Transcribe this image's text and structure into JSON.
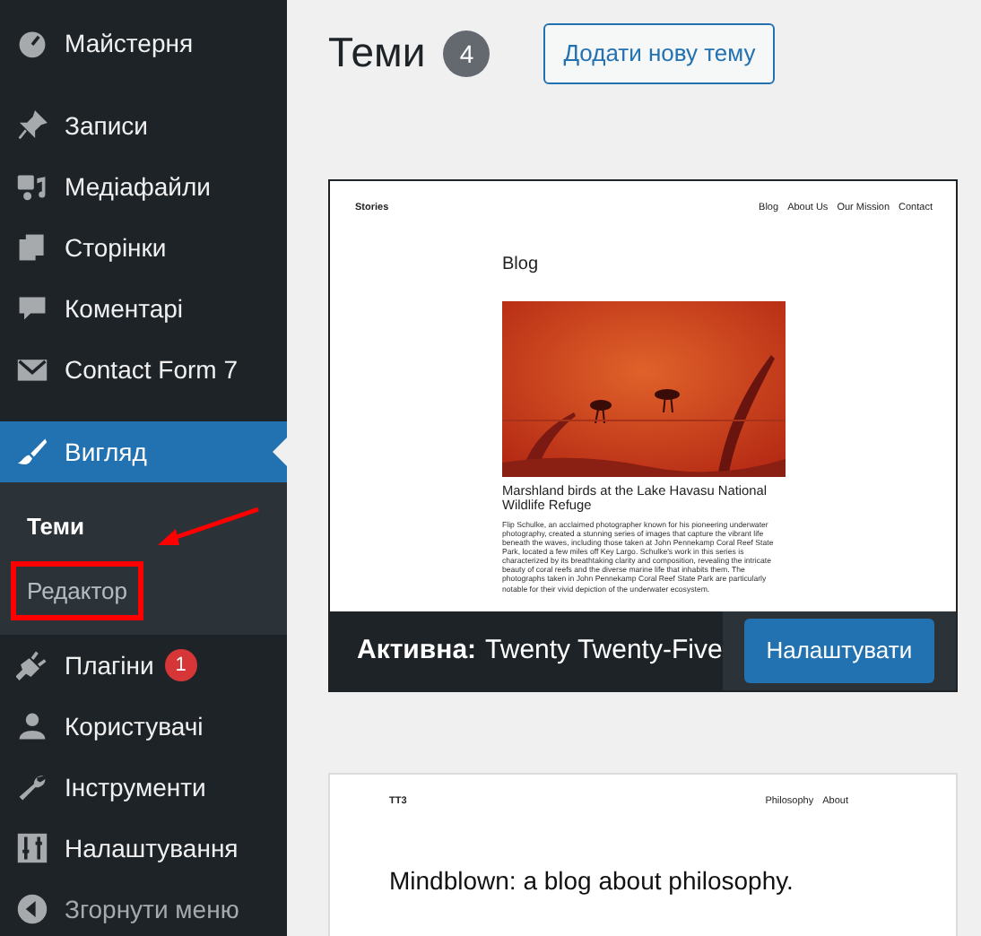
{
  "sidebar": {
    "groups": [
      [
        {
          "label": "Майстерня",
          "current": false
        }
      ],
      [
        {
          "label": "Записи",
          "current": false
        },
        {
          "label": "Медіафайли",
          "current": false
        },
        {
          "label": "Сторінки",
          "current": false
        },
        {
          "label": "Коментарі",
          "current": false
        },
        {
          "label": "Contact Form 7",
          "current": false
        }
      ],
      [
        {
          "label": "Вигляд",
          "current": true,
          "children": [
            {
              "label": "Теми",
              "selected": true,
              "highlighted": false
            },
            {
              "label": "Редактор",
              "selected": false,
              "highlighted": true
            }
          ]
        },
        {
          "label": "Плагіни",
          "current": false,
          "badge": "1"
        },
        {
          "label": "Користувачі",
          "current": false
        },
        {
          "label": "Інструменти",
          "current": false
        },
        {
          "label": "Налаштування",
          "current": false
        }
      ]
    ],
    "collapse": "Згорнути меню"
  },
  "header": {
    "title": "Теми",
    "count": "4",
    "add_button": "Додати нову тему"
  },
  "themes": [
    {
      "kind": "blog",
      "active": true,
      "site_title": "Stories",
      "nav": [
        "Blog",
        "About Us",
        "Our Mission",
        "Contact"
      ],
      "heading": "Blog",
      "post_title": "Marshland birds at the Lake Havasu National Wildlife Refuge",
      "excerpt": "Flip Schulke, an acclaimed photographer known for his pioneering underwater photography, created a stunning series of images that capture the vibrant life beneath the waves, including those taken at John Pennekamp Coral Reef State Park, located a few miles off Key Largo. Schulke's work in this series is characterized by its breathtaking clarity and composition, revealing the intricate beauty of coral reefs and the diverse marine life that inhabits them. The photographs taken in John Pennekamp Coral Reef State Park are particularly notable for their vivid depiction of the underwater ecosystem.",
      "active_label": "Активна:",
      "name": "Twenty Twenty-Five",
      "button": "Налаштувати"
    },
    {
      "kind": "simple",
      "active": false,
      "site_title": "TT3",
      "nav": [
        "Philosophy",
        "About"
      ],
      "heading": "Mindblown: a blog about philosophy."
    }
  ]
}
